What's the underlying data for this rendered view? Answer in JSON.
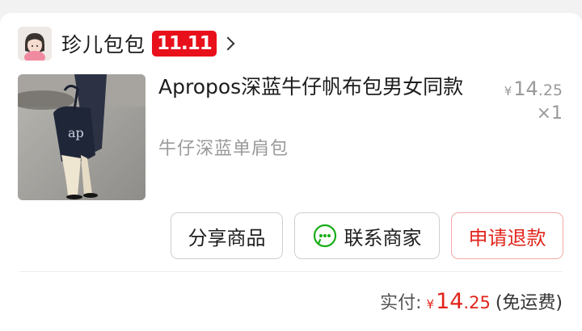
{
  "store": {
    "name": "珍儿包包",
    "promo_badge": "11.11"
  },
  "product": {
    "title": "Apropos深蓝牛仔帆布包男女同款",
    "variant": "牛仔深蓝单肩包",
    "price_symbol": "¥",
    "price_int": "14",
    "price_cents": ".25",
    "quantity": "×1"
  },
  "actions": {
    "share": "分享商品",
    "contact": "联系商家",
    "refund": "申请退款"
  },
  "total": {
    "label": "实付:",
    "symbol": "¥",
    "int": "14",
    "cents": ".25",
    "shipping": "(免运费)"
  },
  "colors": {
    "accent_red": "#e1251b",
    "badge_red": "#e8101b",
    "wechat_green": "#1aad19"
  }
}
